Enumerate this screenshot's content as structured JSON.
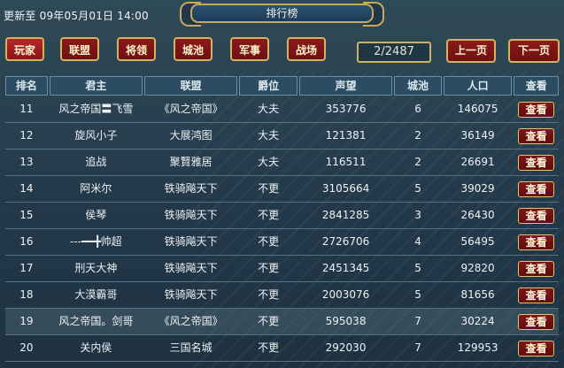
{
  "update_text": "更新至 09年05月01日 14:00",
  "title": "排行榜",
  "tabs": [
    "玩家",
    "联盟",
    "将领",
    "城池",
    "军事",
    "战场"
  ],
  "pagination": {
    "page": "2/2487",
    "prev": "上一页",
    "next": "下一页"
  },
  "table": {
    "headers": [
      "排名",
      "君主",
      "联盟",
      "爵位",
      "声望",
      "城池",
      "人口",
      "查看"
    ],
    "view_label": "查看",
    "rows": [
      {
        "rank": "11",
        "lord": "风之帝国〓飞雪",
        "alliance": "《风之帝国》",
        "title": "大夫",
        "prestige": "353776",
        "cities": "6",
        "pop": "146075"
      },
      {
        "rank": "12",
        "lord": "旋风小子",
        "alliance": "大展鸿图",
        "title": "大夫",
        "prestige": "121381",
        "cities": "2",
        "pop": "36149"
      },
      {
        "rank": "13",
        "lord": "追战",
        "alliance": "聚賢雅居",
        "title": "大夫",
        "prestige": "116511",
        "cities": "2",
        "pop": "26691"
      },
      {
        "rank": "14",
        "lord": "阿米尔",
        "alliance": "铁骑飚天下",
        "title": "不更",
        "prestige": "3105664",
        "cities": "5",
        "pop": "39029"
      },
      {
        "rank": "15",
        "lord": "侯琴",
        "alliance": "铁骑飚天下",
        "title": "不更",
        "prestige": "2841285",
        "cities": "3",
        "pop": "26430"
      },
      {
        "rank": "16",
        "lord": "---━━╋帅超",
        "alliance": "铁骑飚天下",
        "title": "不更",
        "prestige": "2726706",
        "cities": "4",
        "pop": "56495"
      },
      {
        "rank": "17",
        "lord": "刑天大神",
        "alliance": "铁骑飚天下",
        "title": "不更",
        "prestige": "2451345",
        "cities": "5",
        "pop": "92820"
      },
      {
        "rank": "18",
        "lord": "大漠霸哥",
        "alliance": "铁骑飚天下",
        "title": "不更",
        "prestige": "2003076",
        "cities": "5",
        "pop": "81656"
      },
      {
        "rank": "19",
        "lord": "风之帝国。剑哥",
        "alliance": "《风之帝国》",
        "title": "不更",
        "prestige": "595038",
        "cities": "7",
        "pop": "30224"
      },
      {
        "rank": "20",
        "lord": "关内侯",
        "alliance": "三国名城",
        "title": "不更",
        "prestige": "292030",
        "cities": "7",
        "pop": "129953"
      }
    ]
  }
}
